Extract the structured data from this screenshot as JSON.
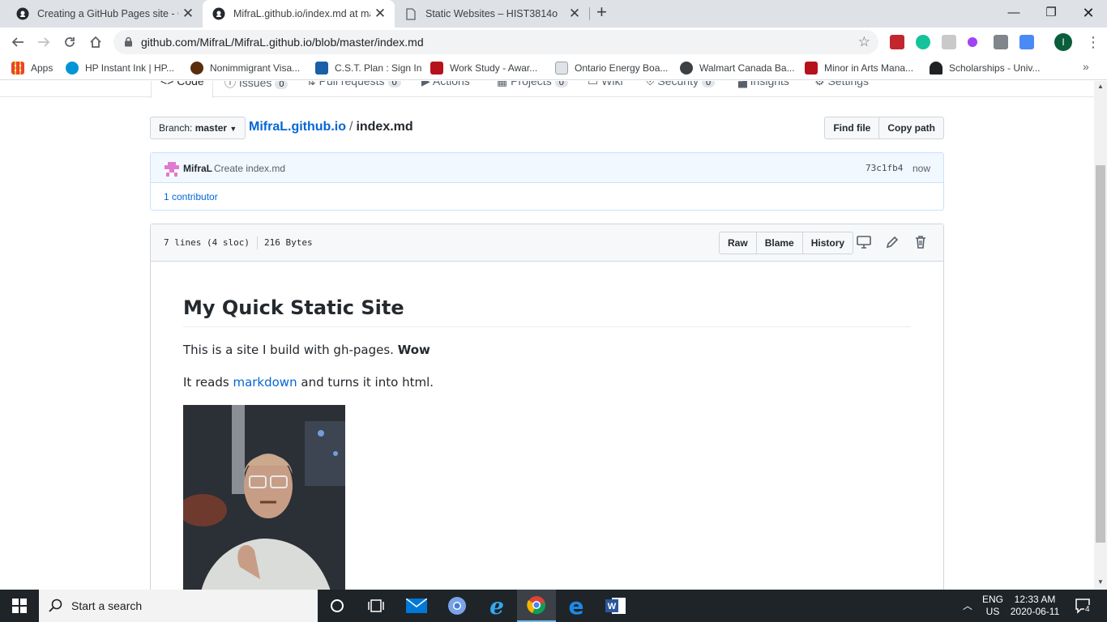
{
  "browser": {
    "tabs": [
      {
        "title": "Creating a GitHub Pages site - Gi",
        "active": false
      },
      {
        "title": "MifraL.github.io/index.md at mas",
        "active": true
      },
      {
        "title": "Static Websites – HIST3814o",
        "active": false
      }
    ],
    "url": "github.com/MifraL/MifraL.github.io/blob/master/index.md",
    "profile_initial": "I",
    "bookmarks": [
      "Apps",
      "HP Instant Ink | HP...",
      "Nonimmigrant Visa...",
      "C.S.T. Plan : Sign In",
      "Work Study - Awar...",
      "Ontario Energy Boa...",
      "Walmart Canada Ba...",
      "Minor in Arts Mana...",
      "Scholarships - Univ..."
    ]
  },
  "repo_nav": {
    "items": [
      {
        "label": "Code"
      },
      {
        "label": "Issues",
        "count": "0"
      },
      {
        "label": "Pull requests",
        "count": "0"
      },
      {
        "label": "Actions"
      },
      {
        "label": "Projects",
        "count": "0"
      },
      {
        "label": "Wiki"
      },
      {
        "label": "Security",
        "count": "0"
      },
      {
        "label": "Insights"
      },
      {
        "label": "Settings"
      }
    ]
  },
  "file_nav": {
    "branch_prefix": "Branch:",
    "branch": "master",
    "repo": "MifraL.github.io",
    "separator": "/",
    "file": "index.md",
    "find_file": "Find file",
    "copy_path": "Copy path"
  },
  "commit": {
    "author": "MifraL",
    "message": "Create index.md",
    "sha": "73c1fb4",
    "when": "now",
    "contributors": "1 contributor"
  },
  "file_header": {
    "lines": "7 lines (4 sloc)",
    "size": "216 Bytes",
    "raw": "Raw",
    "blame": "Blame",
    "history": "History"
  },
  "markdown": {
    "heading": "My Quick Static Site",
    "p1_text": "This is a site I build with gh-pages.",
    "p1_bold": "Wow",
    "p2_before": "It reads",
    "p2_link": "markdown",
    "p2_after": "and turns it into html."
  },
  "taskbar": {
    "search_placeholder": "Start a search",
    "lang": "ENG",
    "region": "US",
    "time": "12:33 AM",
    "date": "2020-06-11",
    "notifications": "4"
  },
  "colors": {
    "link": "#0366d6",
    "tab_accent": "#e36209",
    "commit_bg": "#f1f8ff"
  }
}
